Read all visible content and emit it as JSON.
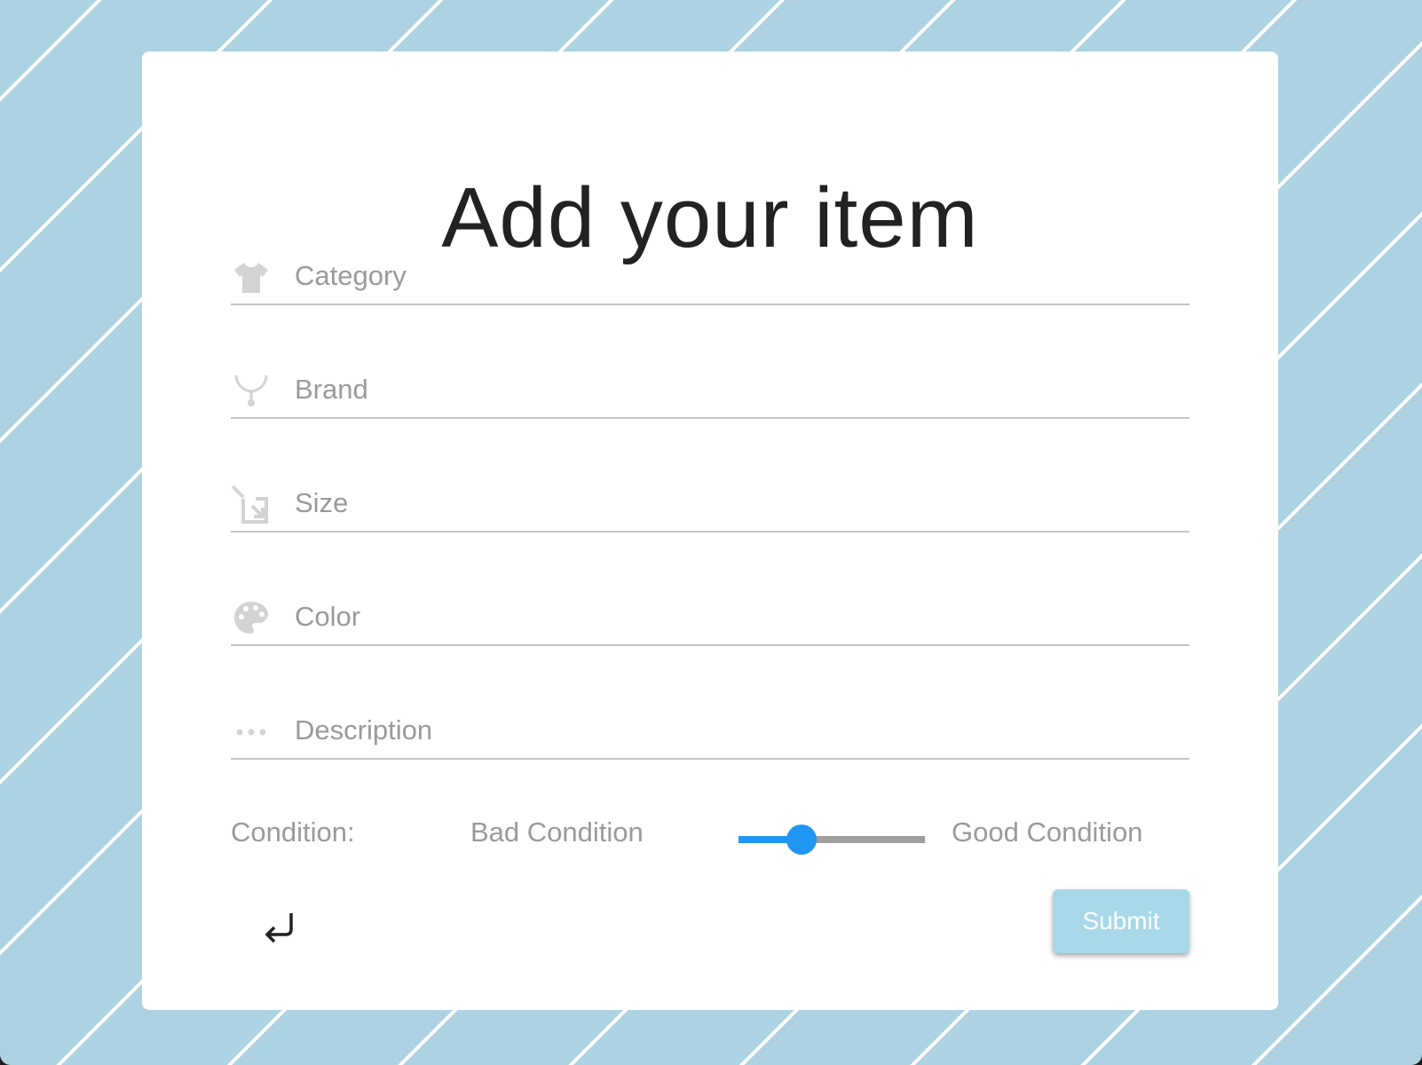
{
  "page": {
    "title": "Add your item"
  },
  "fields": {
    "category": {
      "placeholder": "Category",
      "value": "",
      "icon": "tshirt-icon"
    },
    "brand": {
      "placeholder": "Brand",
      "value": "",
      "icon": "hanger-icon"
    },
    "size": {
      "placeholder": "Size",
      "value": "",
      "icon": "resize-icon"
    },
    "color": {
      "placeholder": "Color",
      "value": "",
      "icon": "palette-icon"
    },
    "description": {
      "placeholder": "Description",
      "value": "",
      "icon": "more-horiz-icon"
    }
  },
  "condition": {
    "label": "Condition:",
    "min_label": "Bad Condition",
    "max_label": "Good Condition",
    "value_fraction": 0.34
  },
  "actions": {
    "back_icon": "return-arrow-icon",
    "submit_label": "Submit"
  },
  "colors": {
    "background": "#add3e2",
    "stripe": "#ffffff",
    "accent": "#2196f3",
    "submit_bg": "#a8d8e8",
    "placeholder": "#9a9a9a",
    "icon": "#d3d3d3"
  }
}
